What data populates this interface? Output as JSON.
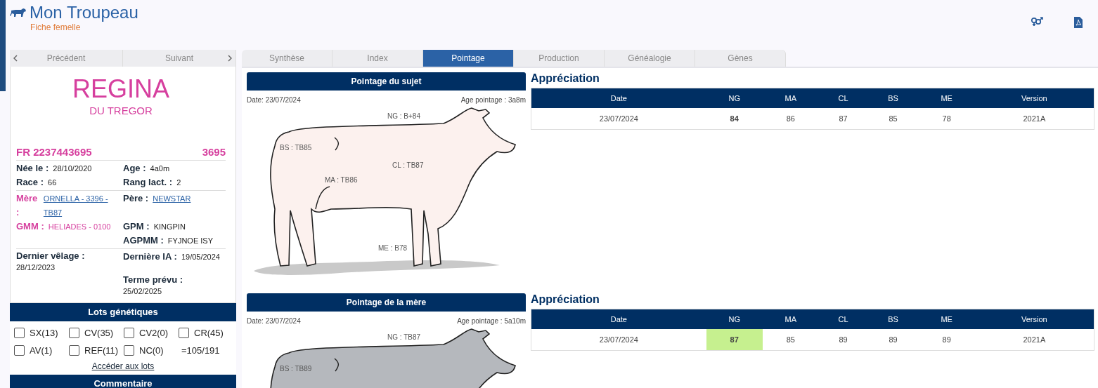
{
  "header": {
    "title": "Mon Troupeau",
    "subtitle": "Fiche femelle"
  },
  "nav": {
    "previous": "Précédent",
    "next": "Suivant"
  },
  "animal": {
    "name": "REGINA",
    "affix": "DU TREGOR",
    "id": "FR 2237443695",
    "work_number": "3695",
    "groups": [
      [
        {
          "label": "Née le :",
          "value": "28/10/2020",
          "kind": "plain"
        },
        {
          "label": "Age :",
          "value": "4a0m",
          "kind": "plain"
        },
        {
          "label": "Race :",
          "value": "66",
          "kind": "plain"
        },
        {
          "label": "Rang lact. :",
          "value": "2",
          "kind": "plain"
        }
      ],
      [
        {
          "label": "Mère :",
          "value": "ORNELLA - 3396 - TB87",
          "kind": "female-link"
        },
        {
          "label": "Père :",
          "value": "NEWSTAR",
          "kind": "link"
        },
        {
          "label": "GMM :",
          "value": "HELIADES - 0100",
          "kind": "female"
        },
        {
          "label": "GPM :",
          "value": "KINGPIN",
          "kind": "plain"
        },
        {
          "kind": "skip"
        },
        {
          "label": "AGPMM :",
          "value": "FYJNOE ISY",
          "kind": "plain"
        }
      ],
      [
        {
          "label": "Dernier vêlage :",
          "value": "28/12/2023",
          "kind": "stacked"
        },
        {
          "label": "Dernière IA :",
          "value": "19/05/2024",
          "kind": "plain"
        },
        {
          "kind": "skip"
        },
        {
          "label": "Terme prévu :",
          "value": "25/02/2025",
          "kind": "stacked"
        }
      ]
    ]
  },
  "lots": {
    "title": "Lots génétiques",
    "items": [
      {
        "label": "SX(13)",
        "checked": false
      },
      {
        "label": "CV(35)",
        "checked": false
      },
      {
        "label": "CV2(0)",
        "checked": false
      },
      {
        "label": "CR(45)",
        "checked": false
      },
      {
        "label": "AV(1)",
        "checked": false
      },
      {
        "label": "REF(11)",
        "checked": false
      },
      {
        "label": "NC(0)",
        "checked": false
      }
    ],
    "total": "=105/191",
    "link": "Accéder aux lots"
  },
  "comment": {
    "title": "Commentaire"
  },
  "tabs": [
    {
      "label": "Synthèse",
      "selected": false
    },
    {
      "label": "Index",
      "selected": false
    },
    {
      "label": "Pointage",
      "selected": true
    },
    {
      "label": "Production",
      "selected": false
    },
    {
      "label": "Généalogie",
      "selected": false
    },
    {
      "label": "Gènes",
      "selected": false
    }
  ],
  "sections": [
    {
      "title": "Pointage du sujet",
      "date": "Date: 23/07/2024",
      "age": "Age pointage : 3a8m",
      "kind": "subject",
      "labels": [
        {
          "kind": "NG",
          "text": "NG : B+84"
        },
        {
          "kind": "BS",
          "text": "BS : TB85"
        },
        {
          "kind": "CL",
          "text": "CL : TB87"
        },
        {
          "kind": "MA",
          "text": "MA : TB86"
        },
        {
          "kind": "ME",
          "text": "ME : B78"
        }
      ],
      "appreciation": {
        "title": "Appréciation",
        "columns": [
          "Date",
          "NG",
          "MA",
          "CL",
          "BS",
          "ME",
          "Version"
        ],
        "row": [
          "23/07/2024",
          "84",
          "86",
          "87",
          "85",
          "78",
          "2021A"
        ],
        "ng_highlighted": false
      }
    },
    {
      "title": "Pointage de la mère",
      "date": "Date: 23/07/2024",
      "age": "Age pointage : 5a10m",
      "kind": "mother",
      "labels": [
        {
          "kind": "NG",
          "text": "NG : TB87"
        },
        {
          "kind": "BS",
          "text": "BS : TB89"
        }
      ],
      "appreciation": {
        "title": "Appréciation",
        "columns": [
          "Date",
          "NG",
          "MA",
          "CL",
          "BS",
          "ME",
          "Version"
        ],
        "row": [
          "23/07/2024",
          "87",
          "85",
          "89",
          "89",
          "89",
          "2021A"
        ],
        "ng_highlighted": true
      }
    }
  ]
}
